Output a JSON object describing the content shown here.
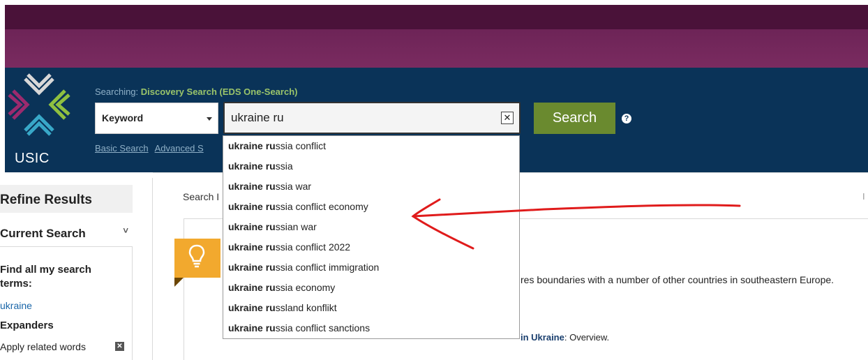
{
  "header": {
    "logo_text": "USIC",
    "searching_prefix": "Searching: ",
    "database": "Discovery Search (EDS One-Search)",
    "field_select": "Keyword",
    "search_value": "ukraine ru",
    "clear_label": "✕",
    "search_button": "Search",
    "help": "?",
    "link_basic": "Basic Search",
    "link_advanced": "Advanced S"
  },
  "suggestions": [
    {
      "match": "ukraine ru",
      "rest": "ssia conflict"
    },
    {
      "match": "ukraine ru",
      "rest": "ssia"
    },
    {
      "match": "ukraine ru",
      "rest": "ssia war"
    },
    {
      "match": "ukraine ru",
      "rest": "ssia conflict economy"
    },
    {
      "match": "ukraine ru",
      "rest": "ssian war"
    },
    {
      "match": "ukraine ru",
      "rest": "ssia conflict 2022"
    },
    {
      "match": "ukraine ru",
      "rest": "ssia conflict immigration"
    },
    {
      "match": "ukraine ru",
      "rest": "ssia economy"
    },
    {
      "match": "ukraine ru",
      "rest": "ssland konflikt"
    },
    {
      "match": "ukraine ru",
      "rest": "ssia conflict sanctions"
    }
  ],
  "sidebar": {
    "refine_title": "Refine Results",
    "current_search": "Current Search",
    "chevron": "˅",
    "find_all": "Find all my search terms:",
    "term": "ukraine",
    "expanders": "Expanders",
    "related": "Apply related words",
    "remove": "✕"
  },
  "main": {
    "search_label": "Search I",
    "snippet": "res boundaries with a number of other countries in southeastern Europe.",
    "overview_link": "in Ukraine",
    "overview_rest": ": Overview.",
    "right_edge": "I"
  },
  "colors": {
    "band_top": "#4a1239",
    "band_mid": "#7a2b60",
    "header": "#0a3358",
    "search_button": "#6a8a2f",
    "database_text": "#9ac46a",
    "tip_badge": "#f2a92e",
    "annotation": "#e01b1b"
  }
}
